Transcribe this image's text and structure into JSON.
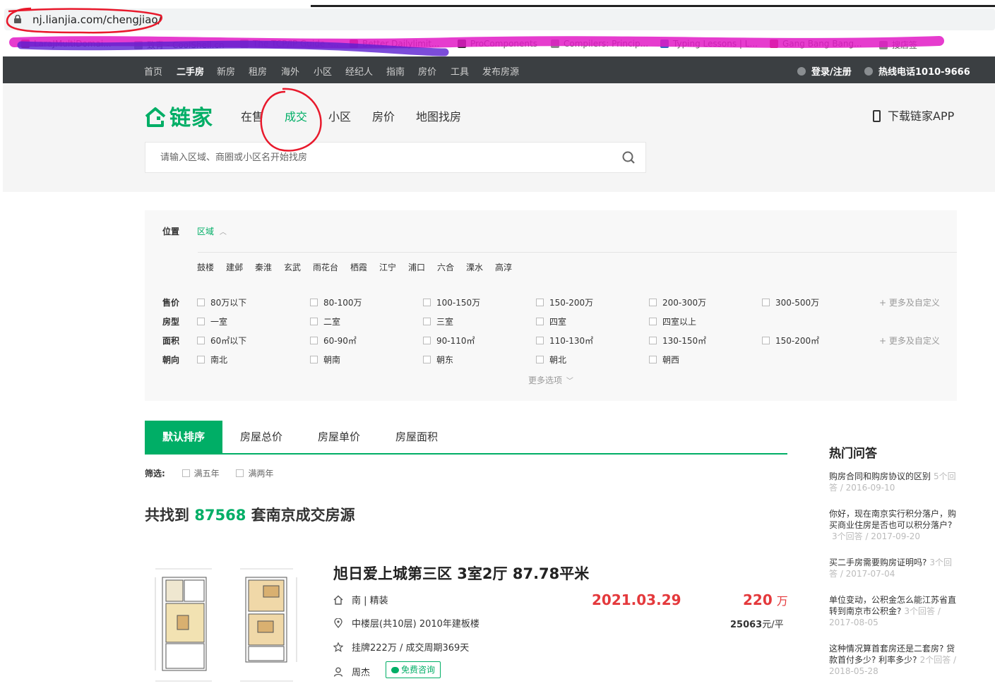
{
  "browser": {
    "url": "nj.lianjia.com/chengjiao/",
    "bookmarks": [
      {
        "label": "LaraJMultiDomai...",
        "color": "#c0392b"
      },
      {
        "label": "致青 - CoolShell.cn",
        "color": "#999999"
      },
      {
        "label": "The TCP/IP Guide -...",
        "color": "#888888"
      },
      {
        "label": "Better Dailylimit...",
        "color": "#a03030"
      },
      {
        "label": "ProComponents",
        "color": "#222222"
      },
      {
        "label": "Compilers: Princip...",
        "color": "#888888"
      },
      {
        "label": "Typing Lessons | L...",
        "color": "#3060c0"
      },
      {
        "label": "Gang Bang Bang...",
        "color": "#c03030"
      },
      {
        "label": "搜店签",
        "color": "#888888"
      }
    ]
  },
  "topnav": {
    "links": [
      "首页",
      "二手房",
      "新房",
      "租房",
      "海外",
      "小区",
      "经纪人",
      "指南",
      "房价",
      "工具",
      "发布房源"
    ],
    "active_index": 1,
    "login": "登录/注册",
    "hotline": "热线电话1010-9666"
  },
  "header": {
    "logo": "链家",
    "nav": [
      "在售",
      "成交",
      "小区",
      "房价",
      "地图找房"
    ],
    "active": "成交",
    "download": "下载链家APP",
    "search_placeholder": "请输入区域、商圈或小区名开始找房"
  },
  "filters": {
    "position_label": "位置",
    "region_tab": "区域",
    "districts": [
      "鼓楼",
      "建邺",
      "秦淮",
      "玄武",
      "雨花台",
      "栖霞",
      "江宁",
      "浦口",
      "六合",
      "溧水",
      "高淳"
    ],
    "price_label": "售价",
    "prices": [
      "80万以下",
      "80-100万",
      "100-150万",
      "150-200万",
      "200-300万",
      "300-500万"
    ],
    "layout_label": "房型",
    "layouts": [
      "一室",
      "二室",
      "三室",
      "四室",
      "四室以上"
    ],
    "area_label": "面积",
    "areas": [
      "60㎡以下",
      "60-90㎡",
      "90-110㎡",
      "110-130㎡",
      "130-150㎡",
      "150-200㎡"
    ],
    "orient_label": "朝向",
    "orients": [
      "南北",
      "朝南",
      "朝东",
      "朝北",
      "朝西"
    ],
    "more_custom": "+ 更多及自定义",
    "more_options": "更多选项"
  },
  "sort": {
    "tabs": [
      "默认排序",
      "房屋总价",
      "房屋单价",
      "房屋面积"
    ],
    "active_index": 0
  },
  "screen": {
    "label": "筛选:",
    "options": [
      "满五年",
      "满两年"
    ]
  },
  "summary": {
    "prefix": "共找到 ",
    "count": "87568",
    "suffix": " 套南京成交房源"
  },
  "listing": {
    "title": "旭日爱上城第三区 3室2厅 87.78平米",
    "orientation": "南 | 精装",
    "floor": "中楼层(共10层) 2010年建板楼",
    "deal": "挂牌222万 / 成交周期369天",
    "agent": "周杰",
    "consult": "免费咨询",
    "deal_date": "2021.03.29",
    "total_price": "220",
    "total_unit": "万",
    "unit_price": "25063",
    "unit_price_suffix": "元/平"
  },
  "sidebar": {
    "title": "热门问答",
    "items": [
      {
        "q": "购房合同和购房协议的区别",
        "meta": "5个回答 / 2016-09-10"
      },
      {
        "q": "你好，现在南京实行积分落户，购买商业住房是否也可以积分落户?",
        "meta": "3个回答 / 2017-09-20"
      },
      {
        "q": "买二手房需要购房证明吗?",
        "meta": "3个回答 / 2017-07-04"
      },
      {
        "q": "单位变动，公积金怎么能江苏省直转到南京市公积金?",
        "meta": "3个回答 / 2017-08-05"
      },
      {
        "q": "这种情况算首套房还是二套房? 贷款首付多少? 利率多少?",
        "meta": "2个回答 / 2018-05-28"
      }
    ]
  },
  "colors": {
    "brand_green": "#00ae66",
    "price_red": "#e4393c",
    "topnav_bg": "#3b3f42",
    "annotation_red": "#e8192c",
    "highlighter": "#6a1fd0"
  }
}
